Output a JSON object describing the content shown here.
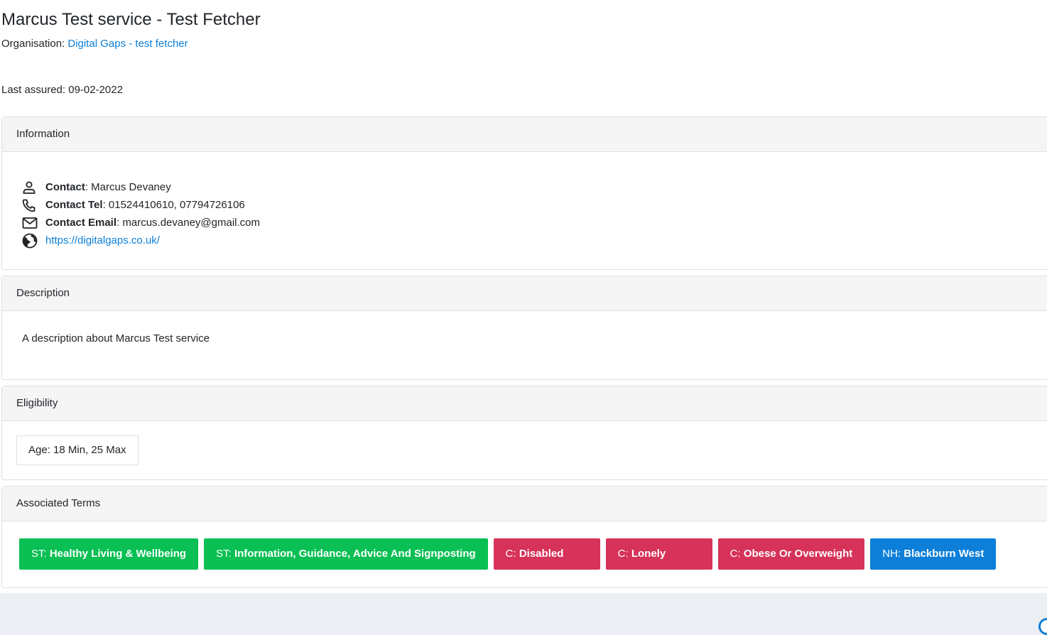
{
  "service": {
    "title": "Marcus Test service - Test Fetcher",
    "organisation_label": "Organisation:",
    "organisation_name": "Digital Gaps - test fetcher",
    "last_assured_label": "Last assured:",
    "last_assured_date": "09-02-2022"
  },
  "information": {
    "header": "Information",
    "contact_label": "Contact",
    "contact_value": ": Marcus Devaney",
    "tel_label": "Contact Tel",
    "tel_value": ": 01524410610, 07794726106",
    "email_label": "Contact Email",
    "email_value": ": marcus.devaney@gmail.com",
    "website": "https://digitalgaps.co.uk/"
  },
  "description": {
    "header": "Description",
    "text": "A description about Marcus Test service"
  },
  "eligibility": {
    "header": "Eligibility",
    "age": "Age: 18 Min, 25 Max"
  },
  "terms": {
    "header": "Associated Terms",
    "items": [
      {
        "prefix": "ST: ",
        "label": "Healthy Living & Wellbeing",
        "color": "#0abf53"
      },
      {
        "prefix": "ST: ",
        "label": "Information, Guidance, Advice And Signposting",
        "color": "#0abf53"
      },
      {
        "prefix": "C: ",
        "label": "Disabled",
        "color": "#d6325a"
      },
      {
        "prefix": "C: ",
        "label": "Lonely",
        "color": "#d6325a"
      },
      {
        "prefix": "C: ",
        "label": "Obese Or Overweight",
        "color": "#d6325a"
      },
      {
        "prefix": "NH: ",
        "label": "Blackburn West",
        "color": "#0d7fd8"
      }
    ]
  },
  "icons": {
    "contact": "person-icon",
    "tel": "phone-icon",
    "email": "envelope-icon",
    "website": "globe-icon"
  }
}
